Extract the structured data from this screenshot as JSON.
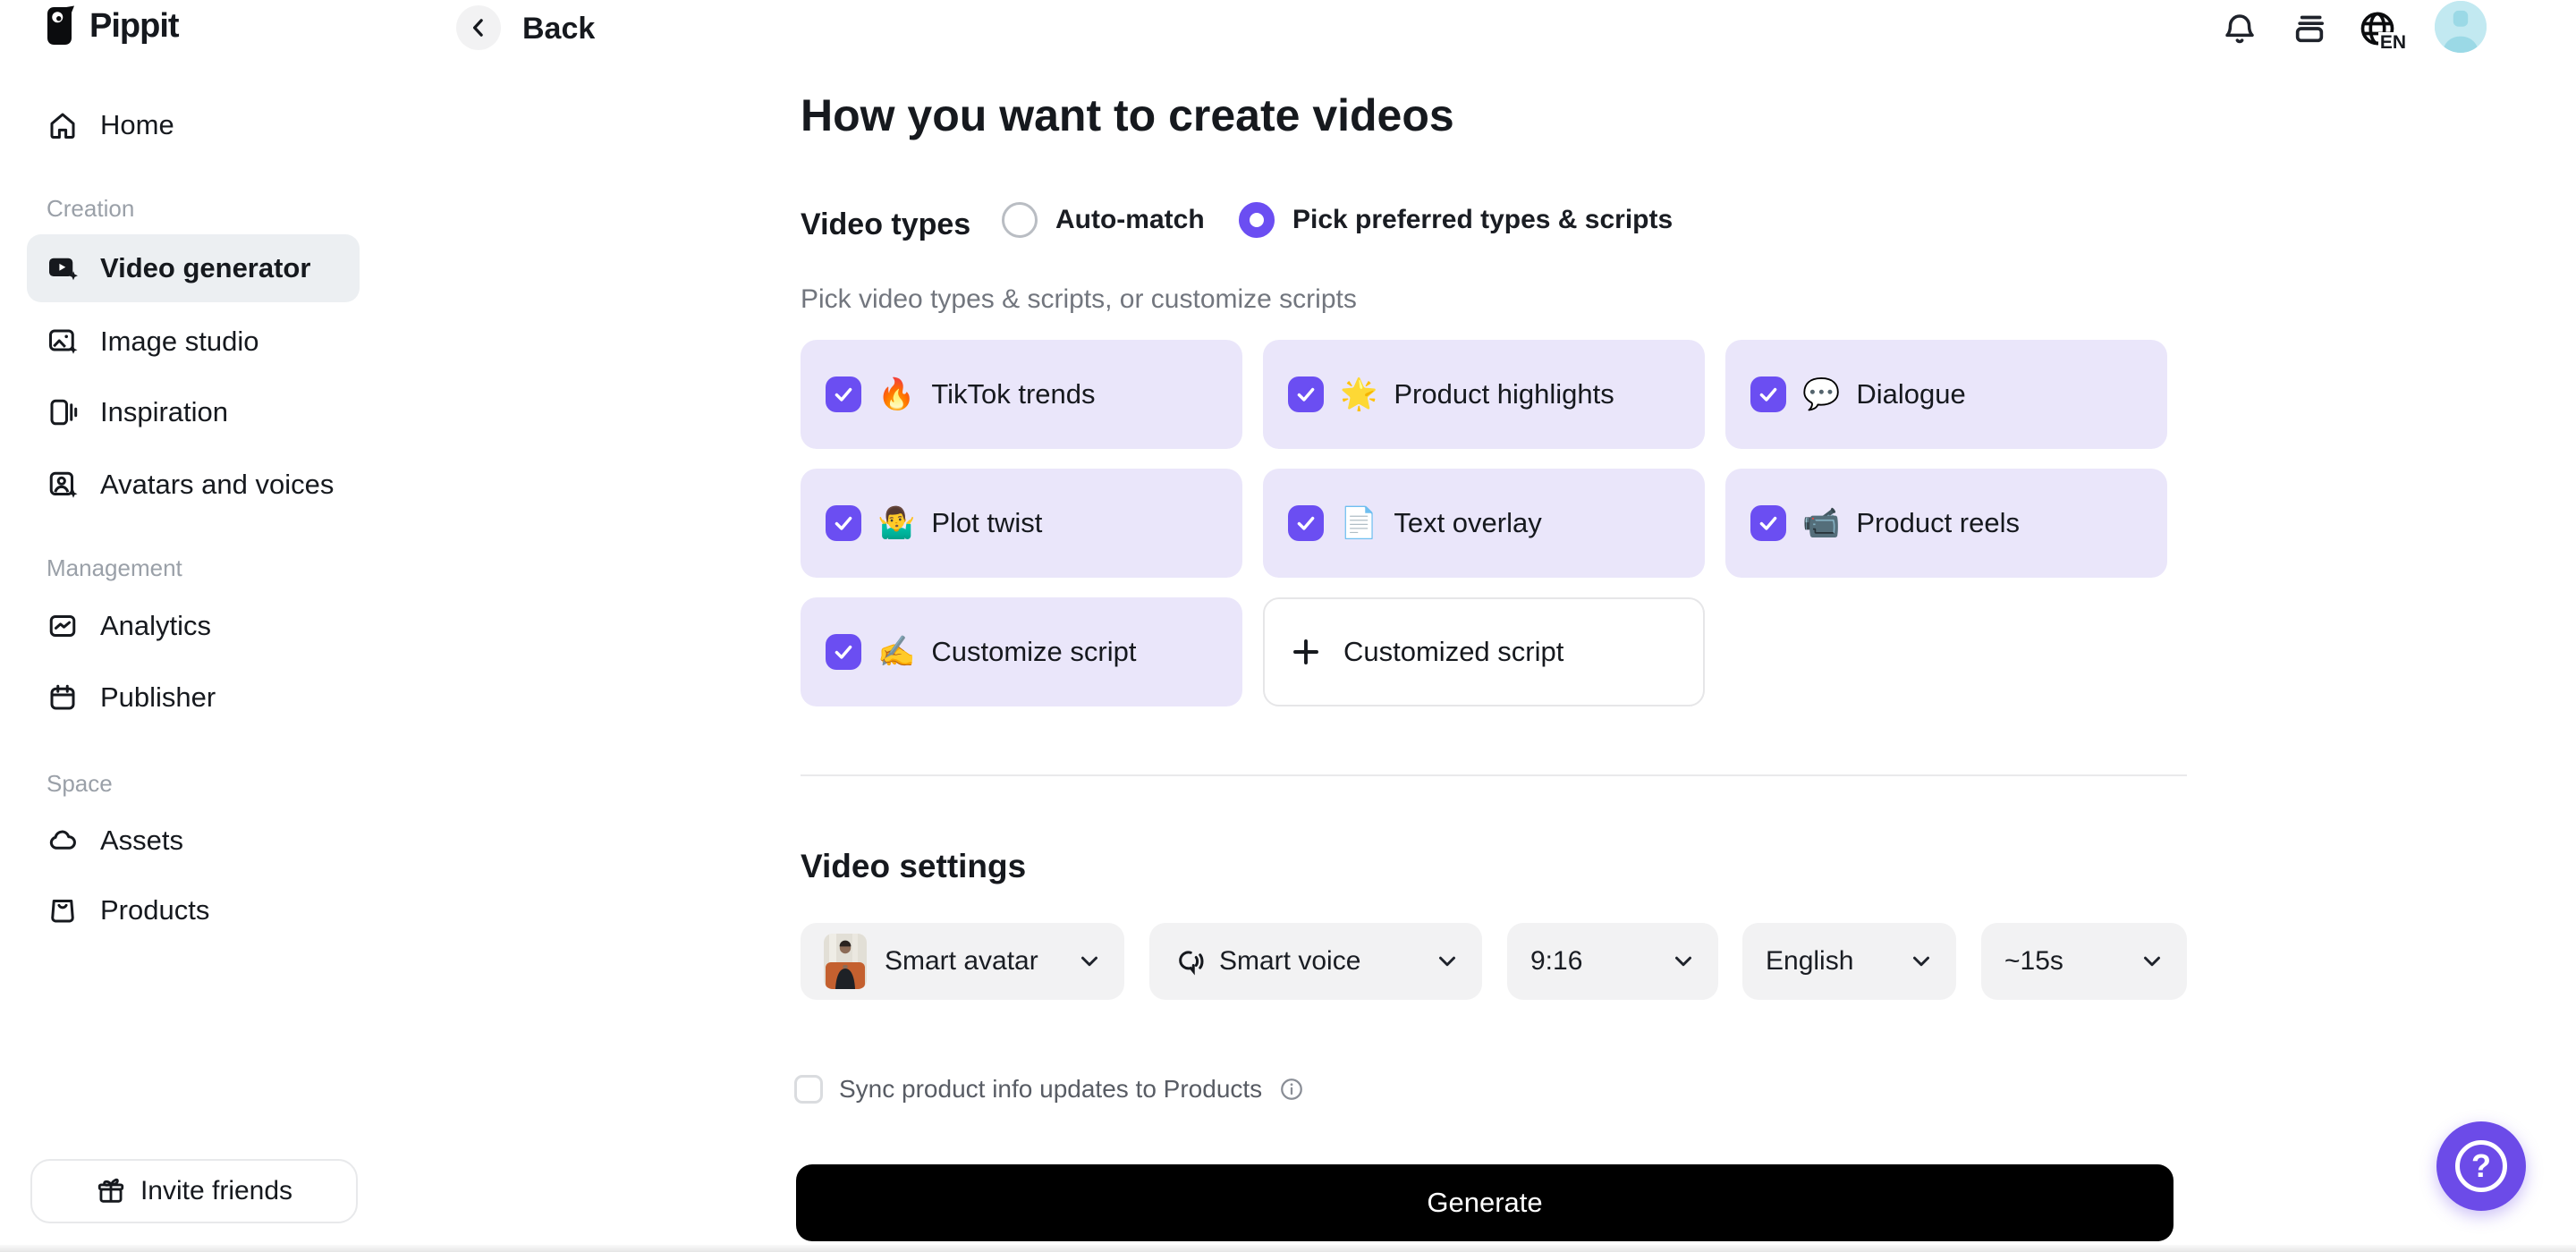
{
  "brand": {
    "name": "Pippit"
  },
  "header": {
    "back_label": "Back",
    "language": "EN",
    "icons": [
      "notification-bell",
      "subscription-stack",
      "language-globe",
      "user-avatar"
    ]
  },
  "sidebar": {
    "home_label": "Home",
    "sections": [
      {
        "label": "Creation",
        "items": [
          {
            "label": "Video generator",
            "icon": "video-generator-icon",
            "active": true
          },
          {
            "label": "Image studio",
            "icon": "image-studio-icon",
            "active": false
          },
          {
            "label": "Inspiration",
            "icon": "inspiration-icon",
            "active": false
          },
          {
            "label": "Avatars and voices",
            "icon": "avatars-icon",
            "active": false
          }
        ]
      },
      {
        "label": "Management",
        "items": [
          {
            "label": "Analytics",
            "icon": "analytics-icon",
            "active": false
          },
          {
            "label": "Publisher",
            "icon": "publisher-icon",
            "active": false
          }
        ]
      },
      {
        "label": "Space",
        "items": [
          {
            "label": "Assets",
            "icon": "assets-icon",
            "active": false
          },
          {
            "label": "Products",
            "icon": "products-icon",
            "active": false
          }
        ]
      }
    ],
    "invite_label": "Invite friends"
  },
  "main": {
    "title": "How you want to create videos",
    "video_types": {
      "label": "Video types",
      "options": [
        {
          "label": "Auto-match",
          "selected": false
        },
        {
          "label": "Pick preferred types & scripts",
          "selected": true
        }
      ],
      "hint": "Pick video types & scripts, or customize scripts",
      "cards": [
        {
          "emoji": "🔥",
          "label": "TikTok trends",
          "checked": true
        },
        {
          "emoji": "🌟",
          "label": "Product highlights",
          "checked": true
        },
        {
          "emoji": "💬",
          "label": "Dialogue",
          "checked": true
        },
        {
          "emoji": "🤷‍♂️",
          "label": "Plot twist",
          "checked": true
        },
        {
          "emoji": "📄",
          "label": "Text overlay",
          "checked": true
        },
        {
          "emoji": "📹",
          "label": "Product reels",
          "checked": true
        },
        {
          "emoji": "✍️",
          "label": "Customize script",
          "checked": true
        }
      ],
      "add_card_label": "Customized script"
    },
    "video_settings": {
      "title": "Video settings",
      "dropdowns": [
        {
          "label": "Smart avatar"
        },
        {
          "label": "Smart voice"
        },
        {
          "label": "9:16"
        },
        {
          "label": "English"
        },
        {
          "label": "~15s"
        }
      ],
      "sync_label": "Sync product info updates to Products",
      "sync_checked": false
    },
    "generate_label": "Generate"
  },
  "colors": {
    "accent_purple": "#6B4EF2",
    "help_purple": "#6C4BE8",
    "card_lavender": "#EAE6FA",
    "sidebar_active": "#ECEFF2",
    "avatar_teal": "#C2E9F1",
    "pill_gray": "#F2F2F3",
    "generate_black": "#000000"
  }
}
